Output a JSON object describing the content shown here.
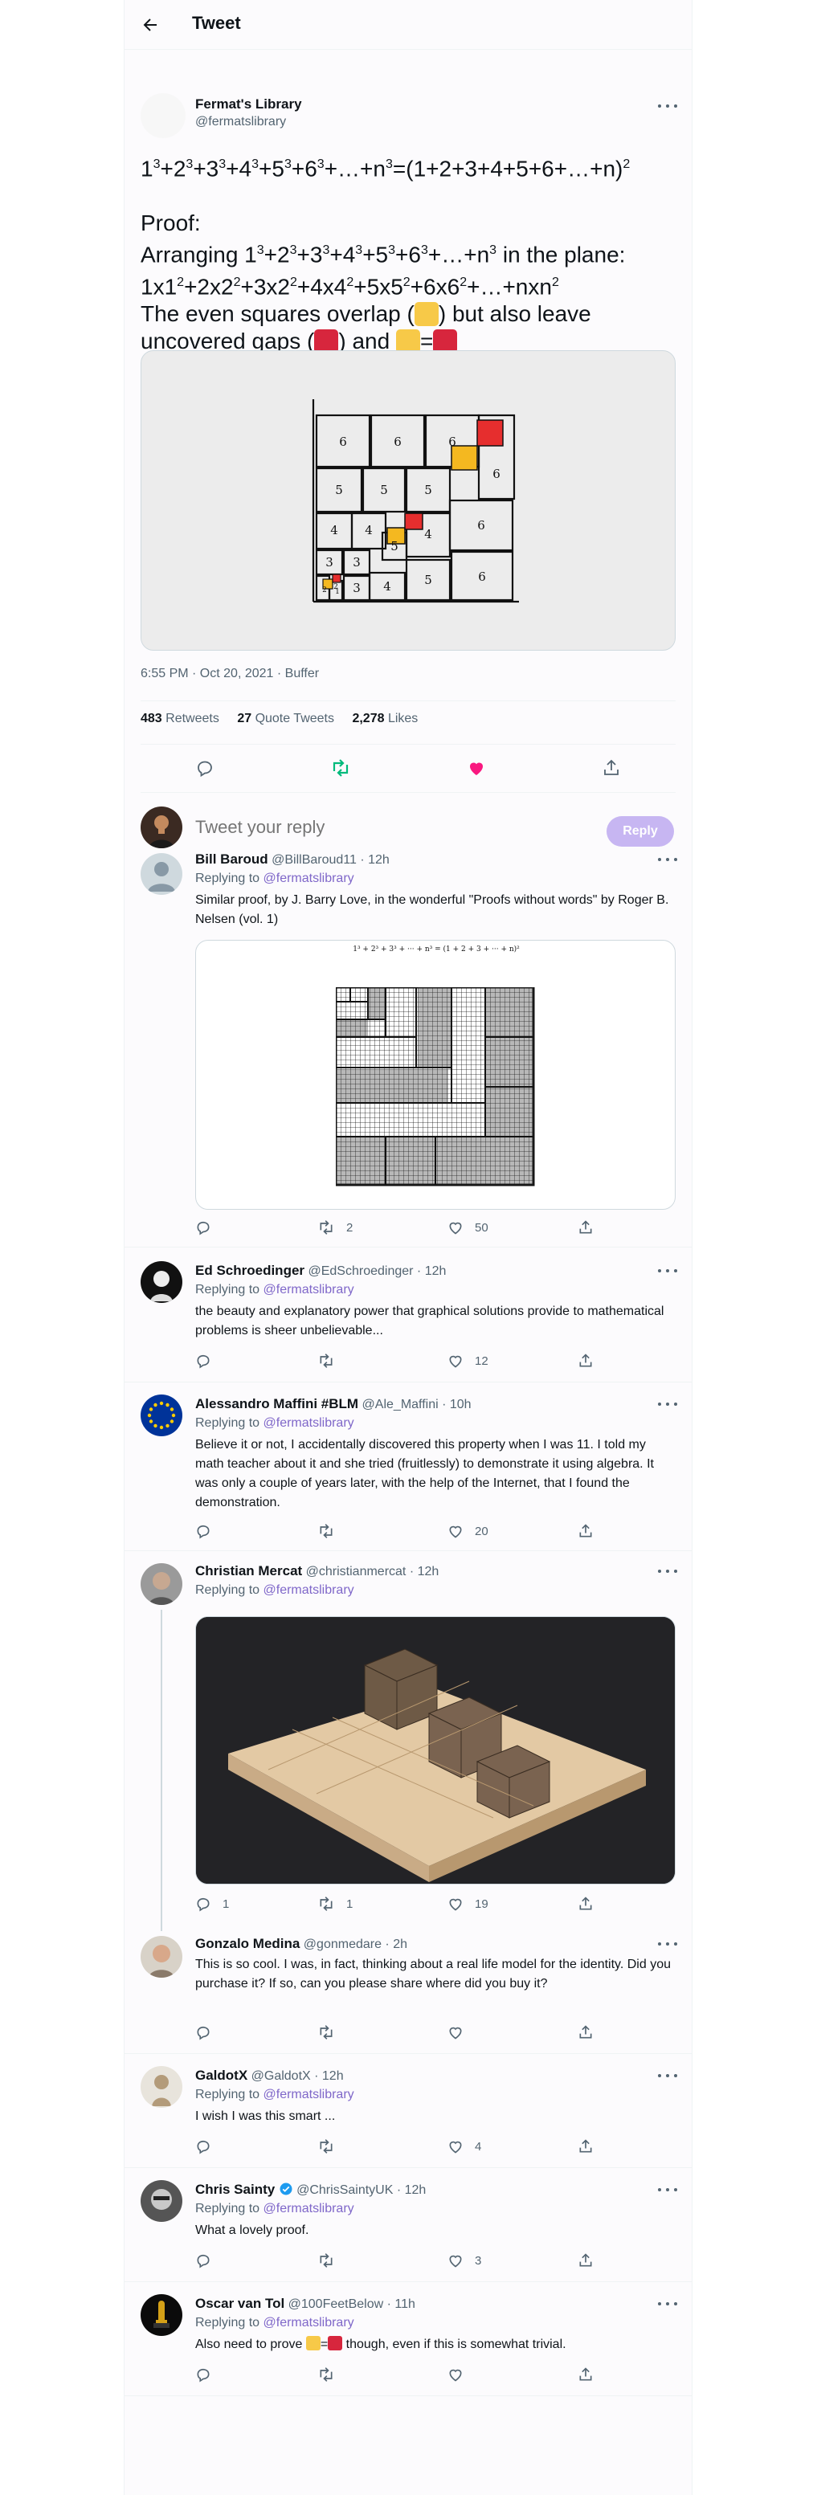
{
  "header": {
    "title": "Tweet"
  },
  "main_tweet": {
    "author_name": "Fermat's Library",
    "author_handle": "@fermatslibrary",
    "line1_parts": [
      "1",
      "3",
      "+2",
      "3",
      "+3",
      "3",
      "+4",
      "3",
      "+5",
      "3",
      "+6",
      "3",
      "+…+n",
      "3",
      "=(1+2+3+4+5+6+…+n)",
      "2"
    ],
    "proof_label": "Proof:",
    "arranging_prefix": "Arranging 1",
    "arranging_parts": [
      "3",
      "+2",
      "3",
      "+3",
      "3",
      "+4",
      "3",
      "+5",
      "3",
      "+6",
      "3",
      "+…+n",
      "3"
    ],
    "arranging_suffix": " in the plane:",
    "line3_parts": [
      "1x1",
      "2",
      "+2x2",
      "2",
      "+3x2",
      "2",
      "+4x4",
      "2",
      "+5x5",
      "2",
      "+6x6",
      "2",
      "+…+nxn",
      "2"
    ],
    "overlap_pre": "The even squares overlap (",
    "overlap_post": ") but also leave",
    "gaps_pre": "uncovered gaps (",
    "gaps_mid": ") and ",
    "gaps_eq": "=",
    "diagram_labels": [
      "6",
      "6",
      "6",
      "6",
      "5",
      "5",
      "5",
      "6",
      "4",
      "4",
      "5",
      "4",
      "3",
      "3",
      "2",
      "1",
      "2",
      "3",
      "4",
      "5",
      "6"
    ],
    "timestamp": "6:55 PM · Oct 20, 2021 · Buffer",
    "retweets_count": "483",
    "retweets_label": "Retweets",
    "quotes_count": "27",
    "quotes_label": "Quote Tweets",
    "likes_count": "2,278",
    "likes_label": "Likes"
  },
  "reply_box": {
    "placeholder": "Tweet your reply",
    "button": "Reply"
  },
  "replies": [
    {
      "name": "Bill Baroud",
      "meta": "@BillBaroud11 · 12h",
      "replying_label": "Replying to",
      "replying_to": "@fermatslibrary",
      "text": "Similar proof, by J. Barry Love, in the wonderful \"Proofs without words\" by Roger B. Nelsen (vol. 1)",
      "image_caption": "1³ + 2³ + 3³ + ··· + n³ = (1 + 2 + 3 + ··· + n)²",
      "replies": "",
      "retweets": "2",
      "likes": "50"
    },
    {
      "name": "Ed Schroedinger",
      "meta": "@EdSchroedinger · 12h",
      "replying_label": "Replying to",
      "replying_to": "@fermatslibrary",
      "text": "the beauty and explanatory power that graphical solutions provide to mathematical problems is sheer unbelievable...",
      "replies": "",
      "retweets": "",
      "likes": "12"
    },
    {
      "name": "Alessandro Maffini #BLM",
      "meta": "@Ale_Maffini · 10h",
      "replying_label": "Replying to",
      "replying_to": "@fermatslibrary",
      "text": "Believe it or not, I accidentally discovered this property when I was 11. I told my math teacher about it and she tried (fruitlessly) to demonstrate it using algebra. It was only a couple of years later, with the help of the Internet, that I found the demonstration.",
      "replies": "",
      "retweets": "",
      "likes": "20"
    },
    {
      "name": "Christian Mercat",
      "meta": "@christianmercat · 12h",
      "replying_label": "Replying to",
      "replying_to": "@fermatslibrary",
      "replies": "1",
      "retweets": "1",
      "likes": "19"
    },
    {
      "name": "Gonzalo Medina",
      "meta": "@gonmedare · 2h",
      "text": "This is so cool. I was, in fact, thinking about a real life model for the identity. Did you purchase it? If so, can you please share where did you buy it?",
      "replies": "",
      "retweets": "",
      "likes": ""
    },
    {
      "name": "GaldotX",
      "meta": "@GaldotX · 12h",
      "replying_label": "Replying to",
      "replying_to": "@fermatslibrary",
      "text": "I wish I was this smart ...",
      "replies": "",
      "retweets": "",
      "likes": "4"
    },
    {
      "name": "Chris Sainty",
      "meta": "@ChrisSaintyUK · 12h",
      "replying_label": "Replying to",
      "replying_to": "@fermatslibrary",
      "text": "What a lovely proof.",
      "replies": "",
      "retweets": "",
      "likes": "3"
    },
    {
      "name": "Oscar van Tol",
      "meta": "@100FeetBelow · 11h",
      "replying_label": "Replying to",
      "replying_to": "@fermatslibrary",
      "text_pre": "Also need to prove ",
      "text_eq": "=",
      "text_post": " though, even if this is somewhat trivial.",
      "replies": "",
      "retweets": "",
      "likes": ""
    }
  ],
  "colors": {
    "accent": "#7f67c9",
    "like": "#f91880",
    "retweet": "#00ba7c",
    "verified": "#1d9bf0"
  }
}
